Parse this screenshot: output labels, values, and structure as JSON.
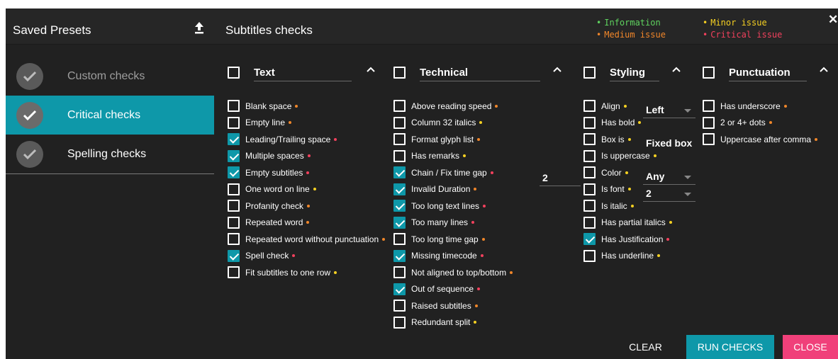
{
  "header": {
    "saved_presets": "Saved Presets",
    "subtitles_checks": "Subtitles checks",
    "legend": {
      "information": "Information",
      "medium": "Medium issue",
      "minor": "Minor issue",
      "critical": "Critical issue"
    },
    "close_label": "✕"
  },
  "colors": {
    "info": "#5fd35f",
    "medium": "#f0862a",
    "minor": "#f5d022",
    "critical": "#f2415d",
    "accent": "#0e98a9",
    "close": "#f0407a"
  },
  "presets": [
    {
      "label": "Custom checks",
      "state": "dim"
    },
    {
      "label": "Critical checks",
      "state": "active"
    },
    {
      "label": "Spelling checks",
      "state": "normal"
    }
  ],
  "columns": {
    "text": {
      "title": "Text",
      "items": [
        {
          "label": "Blank space",
          "checked": false,
          "sev": "medium"
        },
        {
          "label": "Empty line",
          "checked": false,
          "sev": "medium"
        },
        {
          "label": "Leading/Trailing space",
          "checked": true,
          "sev": "critical"
        },
        {
          "label": "Multiple spaces",
          "checked": true,
          "sev": "critical"
        },
        {
          "label": "Empty subtitles",
          "checked": true,
          "sev": "critical"
        },
        {
          "label": "One word on line",
          "checked": false,
          "sev": "minor"
        },
        {
          "label": "Profanity check",
          "checked": false,
          "sev": "medium"
        },
        {
          "label": "Repeated word",
          "checked": false,
          "sev": "medium"
        },
        {
          "label": "Repeated word without punctuation",
          "checked": false,
          "sev": "medium"
        },
        {
          "label": "Spell check",
          "checked": true,
          "sev": "critical"
        },
        {
          "label": "Fit subtitles to one row",
          "checked": false,
          "sev": "minor"
        }
      ]
    },
    "technical": {
      "title": "Technical",
      "chain_value": "2",
      "items": [
        {
          "label": "Above reading speed",
          "checked": false,
          "sev": "medium"
        },
        {
          "label": "Column 32 italics",
          "checked": false,
          "sev": "minor"
        },
        {
          "label": "Format glyph list",
          "checked": false,
          "sev": "medium"
        },
        {
          "label": "Has remarks",
          "checked": false,
          "sev": "minor"
        },
        {
          "label": "Chain / Fix time gap",
          "checked": true,
          "sev": "critical"
        },
        {
          "label": "Invalid Duration",
          "checked": true,
          "sev": "medium"
        },
        {
          "label": "Too long text lines",
          "checked": true,
          "sev": "critical"
        },
        {
          "label": "Too many lines",
          "checked": true,
          "sev": "critical"
        },
        {
          "label": "Too long time gap",
          "checked": false,
          "sev": "medium"
        },
        {
          "label": "Missing timecode",
          "checked": true,
          "sev": "critical"
        },
        {
          "label": "Not aligned to top/bottom",
          "checked": false,
          "sev": "medium"
        },
        {
          "label": "Out of sequence",
          "checked": true,
          "sev": "critical"
        },
        {
          "label": "Raised subtitles",
          "checked": false,
          "sev": "medium"
        },
        {
          "label": "Redundant split",
          "checked": false,
          "sev": "minor"
        }
      ]
    },
    "styling": {
      "title": "Styling",
      "align_value": "Left",
      "box_value": "Fixed box",
      "color_value": "Any",
      "font_value": "2",
      "items": [
        {
          "label": "Align",
          "checked": false,
          "sev": "minor"
        },
        {
          "label": "Has bold",
          "checked": false,
          "sev": "minor"
        },
        {
          "label": "Box is",
          "checked": false,
          "sev": "minor"
        },
        {
          "label": "Is uppercase",
          "checked": false,
          "sev": "minor"
        },
        {
          "label": "Color",
          "checked": false,
          "sev": "minor"
        },
        {
          "label": "Is font",
          "checked": false,
          "sev": "minor"
        },
        {
          "label": "Is italic",
          "checked": false,
          "sev": "minor"
        },
        {
          "label": "Has partial italics",
          "checked": false,
          "sev": "minor"
        },
        {
          "label": "Has Justification",
          "checked": true,
          "sev": "critical"
        },
        {
          "label": "Has underline",
          "checked": false,
          "sev": "minor"
        }
      ]
    },
    "punctuation": {
      "title": "Punctuation",
      "items": [
        {
          "label": "Has underscore",
          "checked": false,
          "sev": "medium"
        },
        {
          "label": "2 or 4+ dots",
          "checked": false,
          "sev": "medium"
        },
        {
          "label": "Uppercase after comma",
          "checked": false,
          "sev": "medium"
        }
      ]
    }
  },
  "footer": {
    "clear": "CLEAR",
    "run": "RUN CHECKS",
    "close": "CLOSE"
  }
}
